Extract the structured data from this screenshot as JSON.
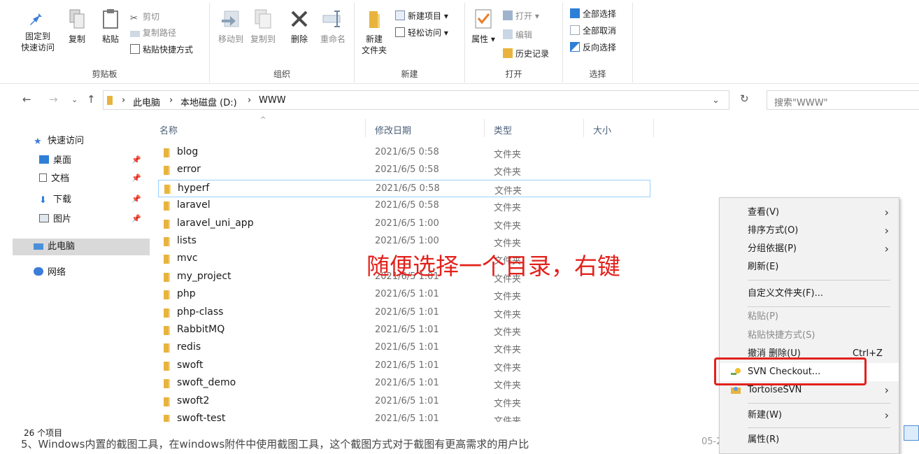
{
  "ribbon": {
    "clipboard": {
      "pin_label_1": "固定到",
      "pin_label_2": "快速访问",
      "copy": "复制",
      "paste": "粘贴",
      "cut": "剪切",
      "copy_path": "复制路径",
      "paste_shortcut": "粘贴快捷方式",
      "group_label": "剪贴板"
    },
    "organize": {
      "move_to": "移动到",
      "copy_to": "复制到",
      "delete": "删除",
      "rename": "重命名",
      "group_label": "组织"
    },
    "new": {
      "new_folder_1": "新建",
      "new_folder_2": "文件夹",
      "new_item": "新建项目",
      "easy_access": "轻松访问",
      "group_label": "新建"
    },
    "open": {
      "properties": "属性",
      "open": "打开",
      "edit": "编辑",
      "history": "历史记录",
      "group_label": "打开"
    },
    "select": {
      "select_all": "全部选择",
      "select_none": "全部取消",
      "invert": "反向选择",
      "group_label": "选择"
    }
  },
  "address": {
    "crumbs": [
      "此电脑",
      "本地磁盘 (D:)",
      "WWW"
    ],
    "separator": "›",
    "search_placeholder": "搜索\"WWW\""
  },
  "navpane": {
    "quick_access": "快速访问",
    "desktop": "桌面",
    "documents": "文档",
    "downloads": "下载",
    "pictures": "图片",
    "this_pc": "此电脑",
    "network": "网络"
  },
  "columns": {
    "name": "名称",
    "date": "修改日期",
    "type": "类型",
    "size": "大小"
  },
  "files": [
    {
      "name": "blog",
      "date": "2021/6/5 0:58",
      "type": "文件夹"
    },
    {
      "name": "error",
      "date": "2021/6/5 0:58",
      "type": "文件夹"
    },
    {
      "name": "hyperf",
      "date": "2021/6/5 0:58",
      "type": "文件夹"
    },
    {
      "name": "laravel",
      "date": "2021/6/5 0:58",
      "type": "文件夹"
    },
    {
      "name": "laravel_uni_app",
      "date": "2021/6/5 1:00",
      "type": "文件夹"
    },
    {
      "name": "lists",
      "date": "2021/6/5 1:00",
      "type": "文件夹"
    },
    {
      "name": "mvc",
      "date": "",
      "type": "文件夹"
    },
    {
      "name": "my_project",
      "date": "2021/6/5 1:01",
      "type": "文件夹"
    },
    {
      "name": "php",
      "date": "2021/6/5 1:01",
      "type": "文件夹"
    },
    {
      "name": "php-class",
      "date": "2021/6/5 1:01",
      "type": "文件夹"
    },
    {
      "name": "RabbitMQ",
      "date": "2021/6/5 1:01",
      "type": "文件夹"
    },
    {
      "name": "redis",
      "date": "2021/6/5 1:01",
      "type": "文件夹"
    },
    {
      "name": "swoft",
      "date": "2021/6/5 1:01",
      "type": "文件夹"
    },
    {
      "name": "swoft_demo",
      "date": "2021/6/5 1:01",
      "type": "文件夹"
    },
    {
      "name": "swoft2",
      "date": "2021/6/5 1:01",
      "type": "文件夹"
    },
    {
      "name": "swoft-test",
      "date": "2021/6/5 1:01",
      "type": "文件夹"
    }
  ],
  "status": "26 个项目",
  "annotation": "随便选择一个目录，右键",
  "below_text": "5、Windows内置的截图工具，在windows附件中使用截图工具，这个截图方式对于截图有更高需求的用户比",
  "below_date": "05-2",
  "context_menu": {
    "view": "查看(V)",
    "sort": "排序方式(O)",
    "group": "分组依据(P)",
    "refresh": "刷新(E)",
    "customize": "自定义文件夹(F)...",
    "paste": "粘贴(P)",
    "paste_shortcut": "粘贴快捷方式(S)",
    "undo_delete": "撤消 删除(U)",
    "undo_shortcut": "Ctrl+Z",
    "svn_checkout": "SVN Checkout...",
    "tortoise": "TortoiseSVN",
    "new": "新建(W)",
    "properties": "属性(R)"
  },
  "colors": {
    "accent_red": "#e3211c",
    "folder": "#e8b43e",
    "hover_border": "#99d1ff"
  }
}
